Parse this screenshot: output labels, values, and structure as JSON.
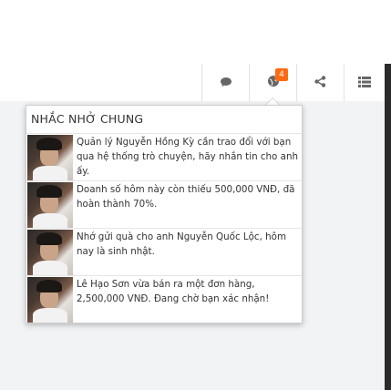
{
  "nav": {
    "badge_count": "4",
    "icons": [
      "comments-icon",
      "globe-icon",
      "share-icon",
      "list-icon"
    ]
  },
  "dropdown": {
    "title": "NHẮC NHỞ CHUNG",
    "items": [
      {
        "message": "Quản lý Nguyễn Hồng Kỳ cần trao đổi với bạn qua hệ thống trò chuyện, hãy nhắn tin cho anh ấy."
      },
      {
        "message": "Doanh số hôm này còn thiếu 500,000 VNĐ, đã hoàn thành 70%."
      },
      {
        "message": "Nhớ gửi quà cho anh Nguyễn Quốc Lộc, hôm nay là sinh nhật."
      },
      {
        "message": "Lê Hạo Sơn vừa bán ra một đơn hàng, 2,500,000 VNĐ. Đang chờ bạn xác nhận!"
      }
    ]
  },
  "colors": {
    "badge": "#ff6a13",
    "content_background": "#f1f3f5",
    "icon": "#666666"
  }
}
